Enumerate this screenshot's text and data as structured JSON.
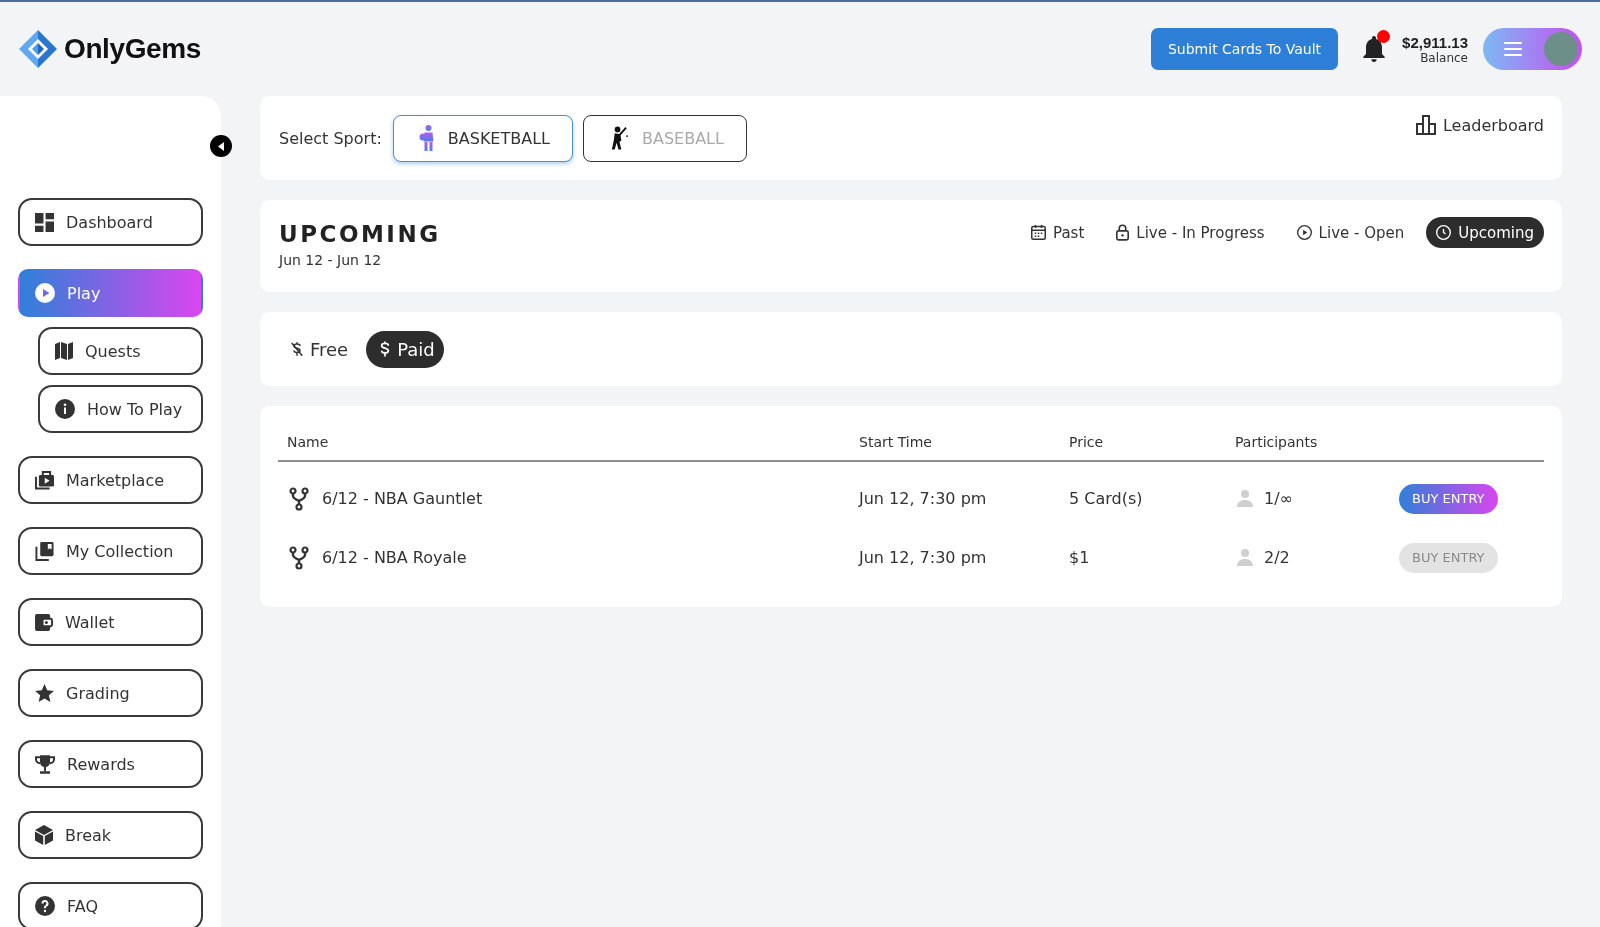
{
  "header": {
    "logo": "OnlyGems",
    "submit_button": "Submit Cards To Vault",
    "notifications": {
      "unread": true
    },
    "balance": {
      "amount": "$2,911.13",
      "label": "Balance"
    }
  },
  "sidebar": {
    "items": [
      {
        "label": "Dashboard",
        "selected": false
      },
      {
        "label": "Play",
        "selected": true,
        "children": [
          {
            "label": "Quests",
            "selected": false
          },
          {
            "label": "How To Play",
            "selected": false
          }
        ]
      },
      {
        "label": "Marketplace",
        "selected": false
      },
      {
        "label": "My Collection",
        "selected": false
      },
      {
        "label": "Wallet",
        "selected": false
      },
      {
        "label": "Grading",
        "selected": false
      },
      {
        "label": "Rewards",
        "selected": false
      },
      {
        "label": "Break",
        "selected": false
      },
      {
        "label": "FAQ",
        "selected": false
      }
    ]
  },
  "sport_selector": {
    "label": "Select Sport:",
    "options": [
      {
        "label": "BASKETBALL",
        "selected": true
      },
      {
        "label": "BASEBALL",
        "selected": false
      }
    ],
    "leaderboard": "Leaderboard"
  },
  "schedule": {
    "title": "UPCOMING",
    "date_range": "Jun 12 - Jun 12",
    "filters": [
      {
        "label": "Past",
        "selected": false
      },
      {
        "label": "Live - In Progress",
        "selected": false
      },
      {
        "label": "Live - Open",
        "selected": false
      },
      {
        "label": "Upcoming",
        "selected": true
      }
    ]
  },
  "entry_filter": {
    "options": [
      {
        "label": "Free",
        "selected": false
      },
      {
        "label": "Paid",
        "selected": true
      }
    ]
  },
  "table": {
    "columns": [
      "Name",
      "Start Time",
      "Price",
      "Participants"
    ],
    "rows": [
      {
        "name": "6/12 - NBA Gauntlet",
        "start_time": "Jun 12, 7:30 pm",
        "price": "5 Card(s)",
        "participants": "1/∞",
        "action": {
          "label": "BUY ENTRY",
          "disabled": false
        }
      },
      {
        "name": "6/12 - NBA Royale",
        "start_time": "Jun 12, 7:30 pm",
        "price": "$1",
        "participants": "2/2",
        "action": {
          "label": "BUY ENTRY",
          "disabled": true
        }
      }
    ]
  }
}
